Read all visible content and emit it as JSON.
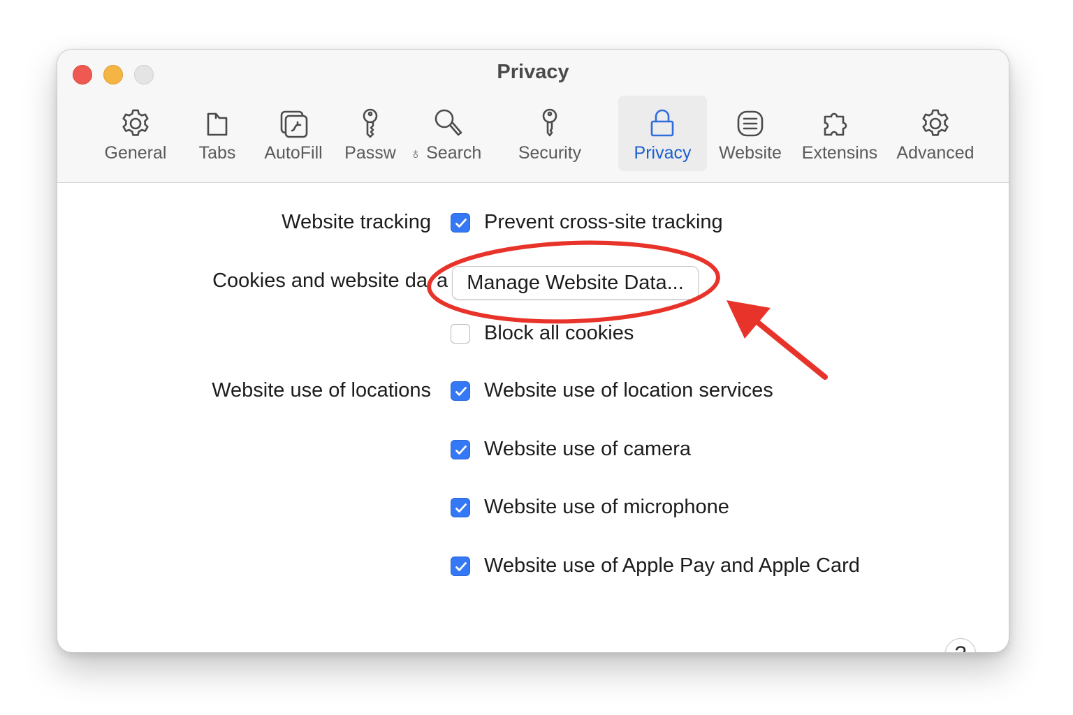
{
  "window": {
    "title": "Privacy"
  },
  "tabs": [
    {
      "id": "general",
      "label": "General",
      "icon": "gear-icon"
    },
    {
      "id": "tabs",
      "label": "Tabs",
      "icon": "tabs-icon"
    },
    {
      "id": "autofill",
      "label": "AutoFill",
      "icon": "autofill-icon"
    },
    {
      "id": "passwords",
      "label": "Passw",
      "icon": "key-icon"
    },
    {
      "id": "search",
      "label": "Search",
      "icon": "magnifier-icon"
    },
    {
      "id": "security",
      "label": "Security",
      "icon": "key-icon"
    },
    {
      "id": "privacy",
      "label": "Privacy",
      "icon": "lock-icon"
    },
    {
      "id": "website",
      "label": "Website",
      "icon": "list-icon"
    },
    {
      "id": "extensions",
      "label": "Extensins",
      "icon": "puzzle-icon"
    },
    {
      "id": "advanced",
      "label": "Advanced",
      "icon": "gear-icon"
    }
  ],
  "selected_tab": "Privacy",
  "accent_color": "#3478f6",
  "annotation_color": "#e8332a",
  "privacy": {
    "tracking_label": "Website tracking",
    "prevent_tracking": {
      "label": "Prevent cross-site tracking",
      "checked": true
    },
    "cookies_label": "Cookies and website da",
    "cookies_label_tail": "a",
    "manage_button": "Manage Website Data...",
    "block_cookies": {
      "label": "Block all cookies",
      "checked": false
    },
    "locations_label": "Website use of locations",
    "location_services": {
      "label": "Website use of location services",
      "checked": true
    },
    "camera": {
      "label": "Website use of camera",
      "checked": true
    },
    "microphone": {
      "label": "Website use of microphone",
      "checked": true
    },
    "apple_pay": {
      "label": "Website use of Apple Pay and Apple Card",
      "checked": true
    }
  },
  "help_button": "?"
}
